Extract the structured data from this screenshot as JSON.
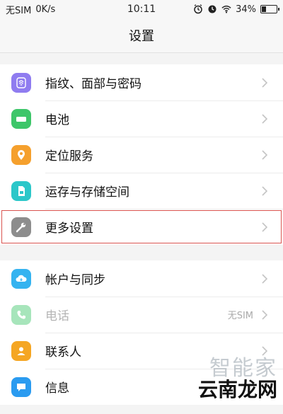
{
  "status": {
    "carrier": "无SIM",
    "speed": "0K/s",
    "time": "10:11",
    "battery": "34%",
    "battery_level": 0.34,
    "icons": [
      "alarm-icon",
      "clock-icon",
      "wifi-icon",
      "battery-icon"
    ]
  },
  "header": {
    "title": "设置"
  },
  "group1": {
    "items": [
      {
        "label": "指纹、面部与密码",
        "icon": "fingerprint-icon",
        "color": "#8f7cf0"
      },
      {
        "label": "电池",
        "icon": "battery-icon",
        "color": "#3ec66a"
      },
      {
        "label": "定位服务",
        "icon": "location-icon",
        "color": "#f5a02d"
      },
      {
        "label": "运存与存储空间",
        "icon": "storage-icon",
        "color": "#2cc7c9"
      },
      {
        "label": "更多设置",
        "icon": "wrench-icon",
        "color": "#8d8d8d"
      }
    ]
  },
  "group2": {
    "items": [
      {
        "label": "帐户与同步",
        "icon": "cloud-icon",
        "color": "#35b3f0"
      },
      {
        "label": "电话",
        "icon": "phone-icon",
        "color": "#3ec66a",
        "value": "无SIM"
      },
      {
        "label": "联系人",
        "icon": "contact-icon",
        "color": "#f5a623"
      },
      {
        "label": "信息",
        "icon": "message-icon",
        "color": "#2a9bf0"
      }
    ]
  },
  "watermark": {
    "top": "智能家",
    "bottom": "云南龙网"
  },
  "colors": {
    "highlight_border": "#d9534f",
    "chevron": "#c4c4c4"
  }
}
